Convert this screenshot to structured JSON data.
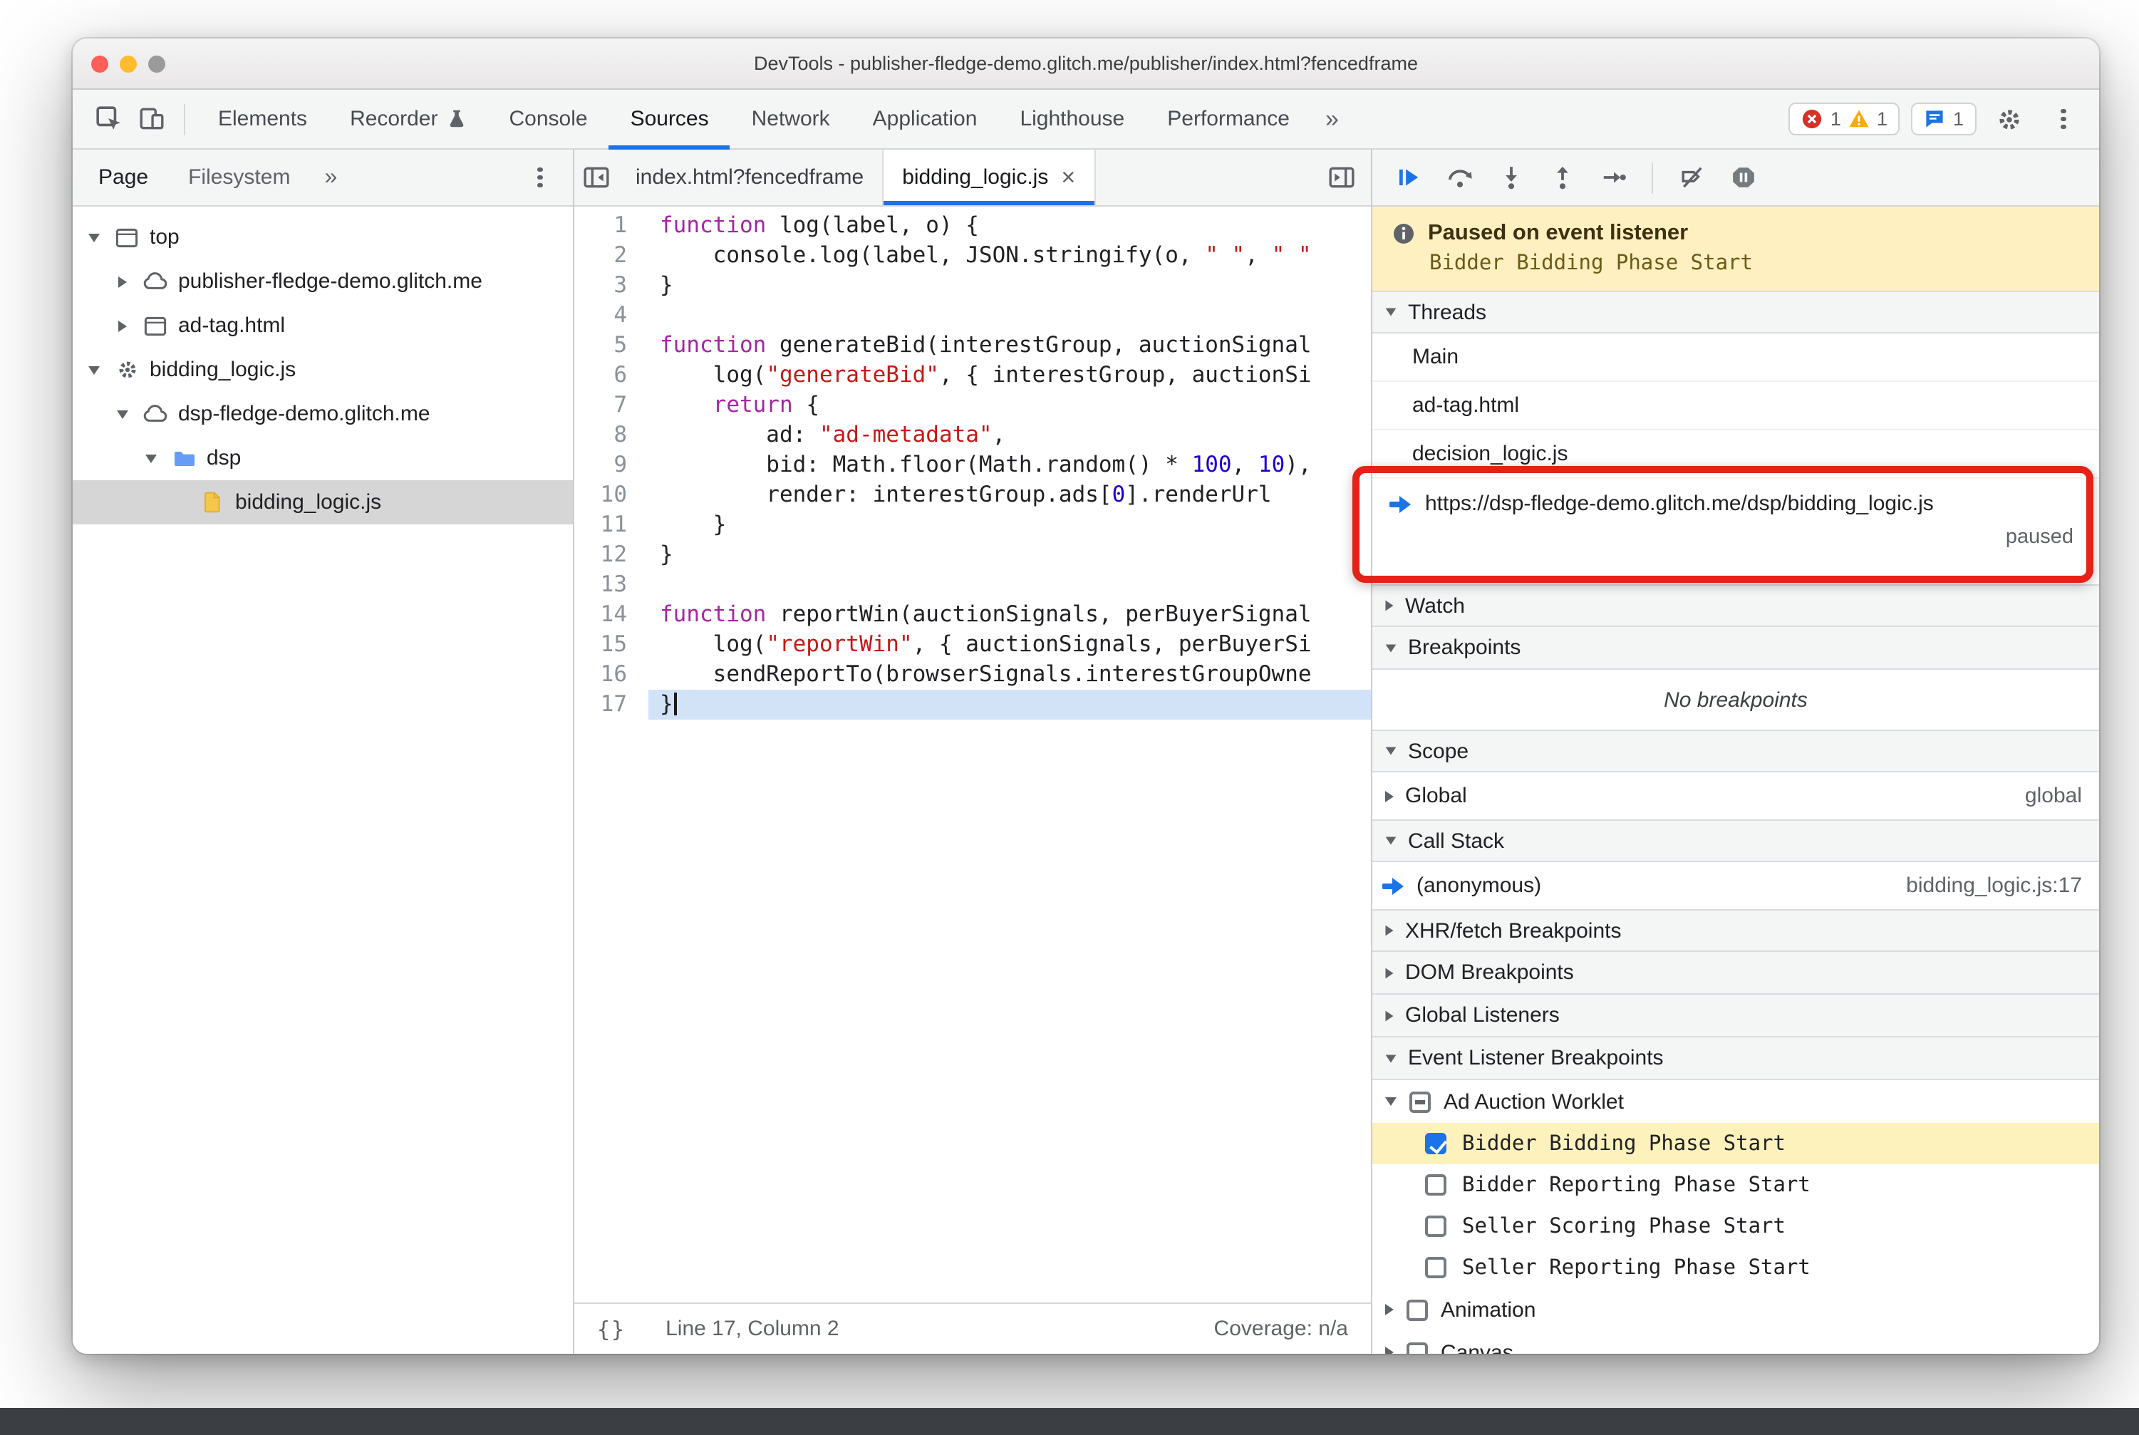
{
  "window": {
    "title": "DevTools - publisher-fledge-demo.glitch.me/publisher/index.html?fencedframe"
  },
  "toolbar": {
    "tabs": [
      {
        "label": "Elements"
      },
      {
        "label": "Recorder",
        "badge": "experiment-flask"
      },
      {
        "label": "Console"
      },
      {
        "label": "Sources",
        "active": true
      },
      {
        "label": "Network"
      },
      {
        "label": "Application"
      },
      {
        "label": "Lighthouse"
      },
      {
        "label": "Performance"
      }
    ],
    "more": "»",
    "error_count": "1",
    "warning_count": "1",
    "issue_count": "1"
  },
  "sidebar": {
    "tabs": [
      {
        "label": "Page",
        "active": true
      },
      {
        "label": "Filesystem"
      }
    ],
    "more": "»",
    "tree": [
      {
        "label": "top",
        "icon": "frame",
        "depth": 0,
        "exp": "open"
      },
      {
        "label": "publisher-fledge-demo.glitch.me",
        "icon": "cloud",
        "depth": 1,
        "exp": "closed"
      },
      {
        "label": "ad-tag.html",
        "icon": "frame",
        "depth": 1,
        "exp": "closed"
      },
      {
        "label": "bidding_logic.js",
        "icon": "worker",
        "depth": 0,
        "exp": "open"
      },
      {
        "label": "dsp-fledge-demo.glitch.me",
        "icon": "cloud",
        "depth": 1,
        "exp": "open"
      },
      {
        "label": "dsp",
        "icon": "folder",
        "depth": 2,
        "exp": "open"
      },
      {
        "label": "bidding_logic.js",
        "icon": "js",
        "depth": 3,
        "exp": "none",
        "selected": true
      }
    ]
  },
  "editor": {
    "tabs": [
      {
        "label": "index.html?fencedframe"
      },
      {
        "label": "bidding_logic.js",
        "active": true,
        "close": "×"
      }
    ],
    "lines": [
      {
        "n": 1,
        "tokens": [
          [
            "k",
            "function"
          ],
          [
            "d",
            " log(label, o) {"
          ]
        ]
      },
      {
        "n": 2,
        "tokens": [
          [
            "d",
            "    console.log(label, JSON.stringify(o, "
          ],
          [
            "s",
            "\" \""
          ],
          [
            "d",
            ", "
          ],
          [
            "s",
            "\" \""
          ]
        ]
      },
      {
        "n": 3,
        "tokens": [
          [
            "d",
            "}"
          ]
        ]
      },
      {
        "n": 4,
        "tokens": []
      },
      {
        "n": 5,
        "tokens": [
          [
            "k",
            "function"
          ],
          [
            "d",
            " generateBid(interestGroup, auctionSignal"
          ]
        ]
      },
      {
        "n": 6,
        "tokens": [
          [
            "d",
            "    log("
          ],
          [
            "s",
            "\"generateBid\""
          ],
          [
            "d",
            ", { interestGroup, auctionSi"
          ]
        ]
      },
      {
        "n": 7,
        "tokens": [
          [
            "d",
            "    "
          ],
          [
            "k",
            "return"
          ],
          [
            "d",
            " {"
          ]
        ]
      },
      {
        "n": 8,
        "tokens": [
          [
            "d",
            "        ad: "
          ],
          [
            "s",
            "\"ad-metadata\""
          ],
          [
            "d",
            ","
          ]
        ]
      },
      {
        "n": 9,
        "tokens": [
          [
            "d",
            "        bid: Math.floor(Math.random() * "
          ],
          [
            "n2",
            "100"
          ],
          [
            "d",
            ", "
          ],
          [
            "n2",
            "10"
          ],
          [
            "d",
            "),"
          ]
        ]
      },
      {
        "n": 10,
        "tokens": [
          [
            "d",
            "        render: interestGroup.ads["
          ],
          [
            "n2",
            "0"
          ],
          [
            "d",
            "].renderUrl"
          ]
        ]
      },
      {
        "n": 11,
        "tokens": [
          [
            "d",
            "    }"
          ]
        ]
      },
      {
        "n": 12,
        "tokens": [
          [
            "d",
            "}"
          ]
        ]
      },
      {
        "n": 13,
        "tokens": []
      },
      {
        "n": 14,
        "tokens": [
          [
            "k",
            "function"
          ],
          [
            "d",
            " reportWin(auctionSignals, perBuyerSignal"
          ]
        ]
      },
      {
        "n": 15,
        "tokens": [
          [
            "d",
            "    log("
          ],
          [
            "s",
            "\"reportWin\""
          ],
          [
            "d",
            ", { auctionSignals, perBuyerSi"
          ]
        ]
      },
      {
        "n": 16,
        "tokens": [
          [
            "d",
            "    sendReportTo(browserSignals.interestGroupOwne"
          ]
        ]
      },
      {
        "n": 17,
        "tokens": [
          [
            "d",
            "}"
          ]
        ],
        "exec": true
      }
    ],
    "status": {
      "format_glyph": "{}",
      "position": "Line 17, Column 2",
      "coverage": "Coverage: n/a"
    }
  },
  "debugger": {
    "paused_banner": {
      "title": "Paused on event listener",
      "detail": "Bidder Bidding Phase Start"
    },
    "threads": {
      "title": "Threads",
      "items": [
        {
          "label": "Main"
        },
        {
          "label": "ad-tag.html"
        },
        {
          "label": "decision_logic.js"
        },
        {
          "label": "https://dsp-fledge-demo.glitch.me/dsp/bidding_logic.js",
          "state": "paused",
          "active": true
        }
      ]
    },
    "watch": {
      "title": "Watch"
    },
    "breakpoints": {
      "title": "Breakpoints",
      "empty": "No breakpoints"
    },
    "scope": {
      "title": "Scope",
      "items": [
        {
          "label": "Global",
          "right": "global"
        }
      ]
    },
    "call_stack": {
      "title": "Call Stack",
      "items": [
        {
          "label": "(anonymous)",
          "right": "bidding_logic.js:17"
        }
      ]
    },
    "xhr": {
      "title": "XHR/fetch Breakpoints"
    },
    "dom": {
      "title": "DOM Breakpoints"
    },
    "global_listeners": {
      "title": "Global Listeners"
    },
    "event_listener_breakpoints": {
      "title": "Event Listener Breakpoints",
      "groups": [
        {
          "label": "Ad Auction Worklet",
          "checkbox": "indeterminate",
          "expanded": true,
          "children": [
            {
              "label": "Bidder Bidding Phase Start",
              "checked": true,
              "highlighted": true
            },
            {
              "label": "Bidder Reporting Phase Start",
              "checked": false
            },
            {
              "label": "Seller Scoring Phase Start",
              "checked": false
            },
            {
              "label": "Seller Reporting Phase Start",
              "checked": false
            }
          ]
        },
        {
          "label": "Animation",
          "checkbox": "unchecked",
          "expanded": false
        },
        {
          "label": "Canvas",
          "checkbox": "unchecked",
          "expanded": false
        }
      ]
    }
  },
  "colors": {
    "accent_blue": "#1a73e8",
    "error_red": "#d93025",
    "warning_yellow": "#f9ab00",
    "annotation_red": "#e62117",
    "paused_banner_bg": "#fff0c2",
    "selected_row_gray": "#d6d6d6",
    "breakpoint_highlight": "#fdf1bc",
    "execution_line_blue": "#d2e3f7"
  }
}
